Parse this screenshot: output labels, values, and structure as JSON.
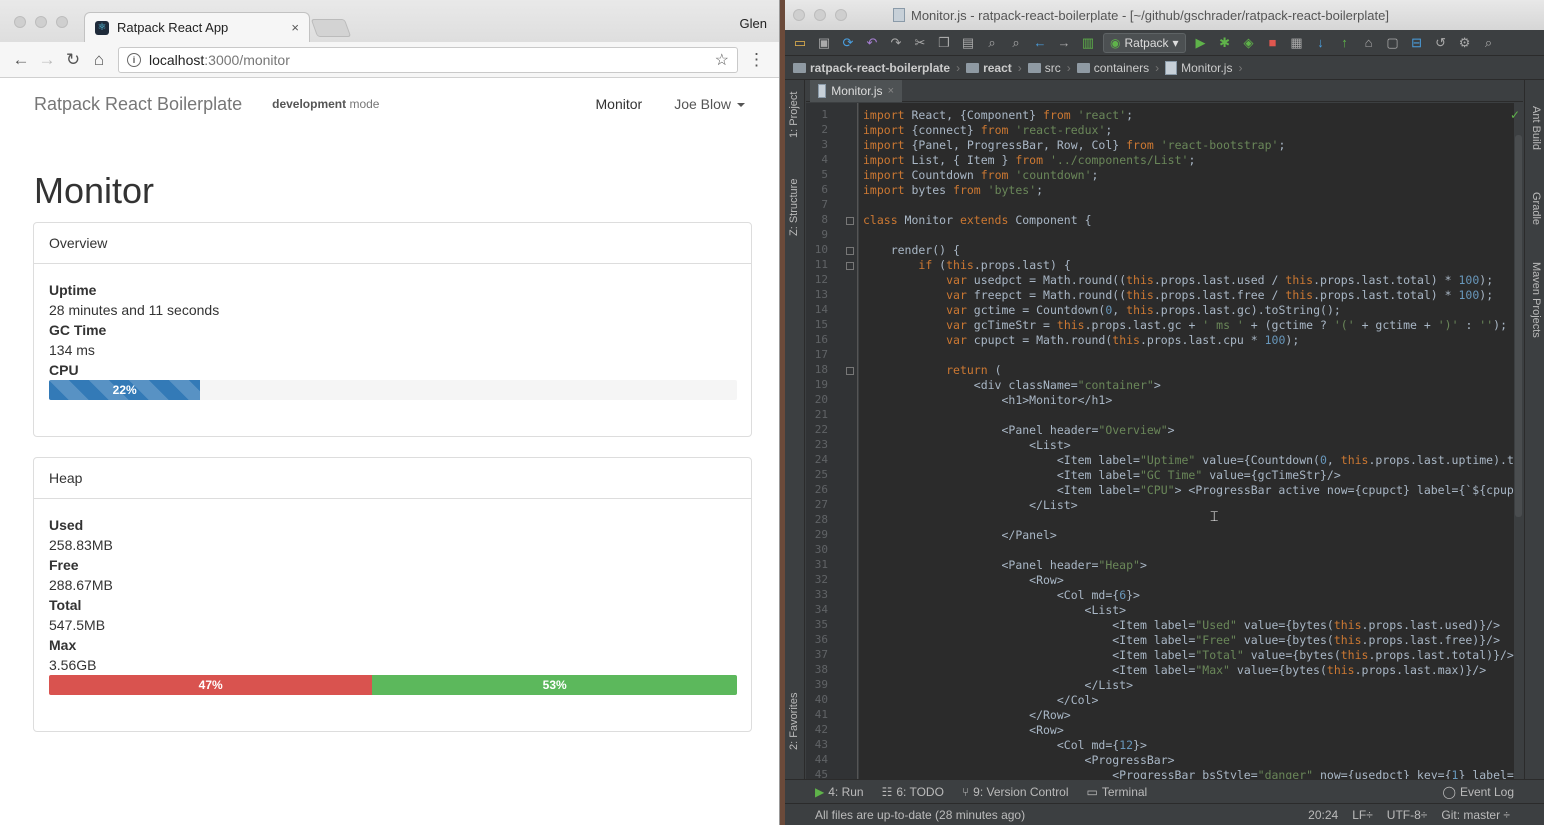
{
  "browser": {
    "tab_title": "Ratpack React App",
    "tab_close": "×",
    "profile": "Glen",
    "url_host": "localhost",
    "url_path": ":3000/monitor",
    "back": "←",
    "reload": "↻",
    "home": "⌂",
    "star": "☆",
    "menu": "⋮"
  },
  "app": {
    "brand": "Ratpack React Boilerplate",
    "mode_bold": "development",
    "mode_rest": " mode",
    "nav_monitor": "Monitor",
    "nav_user": "Joe Blow",
    "title": "Monitor",
    "overview": {
      "header": "Overview",
      "uptime_label": "Uptime",
      "uptime_value": "28 minutes and 11 seconds",
      "gc_label": "GC Time",
      "gc_value": "134 ms",
      "cpu_label": "CPU",
      "cpu_text": "22%",
      "cpu_pct": 22,
      "cpu_color": "#337ab7"
    },
    "heap": {
      "header": "Heap",
      "used_label": "Used",
      "used_value": "258.83MB",
      "free_label": "Free",
      "free_value": "288.67MB",
      "total_label": "Total",
      "total_value": "547.5MB",
      "max_label": "Max",
      "max_value": "3.56GB",
      "used_pct_text": "47%",
      "free_pct_text": "53%",
      "used_pct": 47,
      "free_pct": 53,
      "used_color": "#d9534f",
      "free_color": "#5cb85c"
    }
  },
  "ide": {
    "window_title": "Monitor.js - ratpack-react-boilerplate - [~/github/gschrader/ratpack-react-boilerplate]",
    "run_config": "Ratpack",
    "breadcrumbs": [
      "ratpack-react-boilerplate",
      "react",
      "src",
      "containers",
      "Monitor.js"
    ],
    "editor_tab": "Monitor.js",
    "left_tools": [
      "1: Project",
      "Z: Structure",
      "2: Favorites"
    ],
    "right_tools": [
      "Ant Build",
      "Gradle",
      "Maven Projects"
    ],
    "bottom_tools": [
      "4: Run",
      "6: TODO",
      "9: Version Control",
      "Terminal"
    ],
    "event_log": "Event Log",
    "status_msg": "All files are up-to-date (28 minutes ago)",
    "status_pos": "20:24",
    "status_lf": "LF÷",
    "status_enc": "UTF-8÷",
    "status_git": "Git: master ÷",
    "code_lines": [
      "import React, {Component} from 'react';",
      "import {connect} from 'react-redux';",
      "import {Panel, ProgressBar, Row, Col} from 'react-bootstrap';",
      "import List, { Item } from '../components/List';",
      "import Countdown from 'countdown';",
      "import bytes from 'bytes';",
      "",
      "class Monitor extends Component {",
      "",
      "    render() {",
      "        if (this.props.last) {",
      "            var usedpct = Math.round((this.props.last.used / this.props.last.total) * 100);",
      "            var freepct = Math.round((this.props.last.free / this.props.last.total) * 100);",
      "            var gctime = Countdown(0, this.props.last.gc).toString();",
      "            var gcTimeStr = this.props.last.gc + ' ms ' + (gctime ? '(' + gctime + ')' : '');",
      "            var cpupct = Math.round(this.props.last.cpu * 100);",
      "",
      "            return (",
      "                <div className=\"container\">",
      "                    <h1>Monitor</h1>",
      "",
      "                    <Panel header=\"Overview\">",
      "                        <List>",
      "                            <Item label=\"Uptime\" value={Countdown(0, this.props.last.uptime).t",
      "                            <Item label=\"GC Time\" value={gcTimeStr}/>",
      "                            <Item label=\"CPU\"> <ProgressBar active now={cpupct} label={`${cpup",
      "                        </List>",
      "",
      "                    </Panel>",
      "",
      "                    <Panel header=\"Heap\">",
      "                        <Row>",
      "                            <Col md={6}>",
      "                                <List>",
      "                                    <Item label=\"Used\" value={bytes(this.props.last.used)}/>",
      "                                    <Item label=\"Free\" value={bytes(this.props.last.free)}/>",
      "                                    <Item label=\"Total\" value={bytes(this.props.last.total)}/>",
      "                                    <Item label=\"Max\" value={bytes(this.props.last.max)}/>",
      "                                </List>",
      "                            </Col>",
      "                        </Row>",
      "                        <Row>",
      "                            <Col md={12}>",
      "                                <ProgressBar>",
      "                                    <ProgressBar bsStyle=\"danger\" now={usedpct} key={1} label="
    ]
  }
}
